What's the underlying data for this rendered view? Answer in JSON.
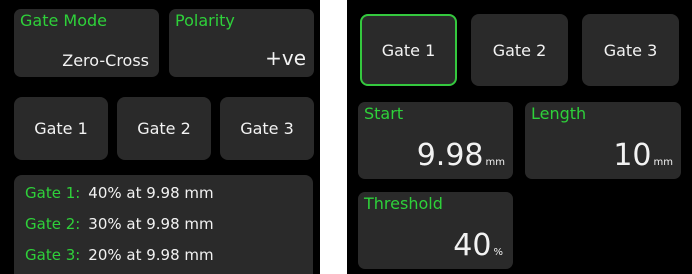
{
  "left": {
    "gate_mode": {
      "label": "Gate Mode",
      "value": "Zero-Cross"
    },
    "polarity": {
      "label": "Polarity",
      "value": "+ve"
    },
    "gate_buttons": [
      "Gate 1",
      "Gate 2",
      "Gate 3"
    ],
    "status": [
      {
        "gate": "Gate 1:",
        "text": "40% at 9.98 mm"
      },
      {
        "gate": "Gate 2:",
        "text": "30% at 9.98 mm"
      },
      {
        "gate": "Gate 3:",
        "text": "20% at 9.98 mm"
      }
    ]
  },
  "right": {
    "gate_buttons": [
      "Gate 1",
      "Gate 2",
      "Gate 3"
    ],
    "selected_gate": "Gate 1",
    "start": {
      "label": "Start",
      "value": "9.98",
      "unit": "mm"
    },
    "length": {
      "label": "Length",
      "value": "10",
      "unit": "mm"
    },
    "threshold": {
      "label": "Threshold",
      "value": "40",
      "unit": "%"
    }
  },
  "colors": {
    "accent": "#2ed13a",
    "tile": "#2a2a2a",
    "background": "#000000",
    "text": "#f2f2f2"
  }
}
